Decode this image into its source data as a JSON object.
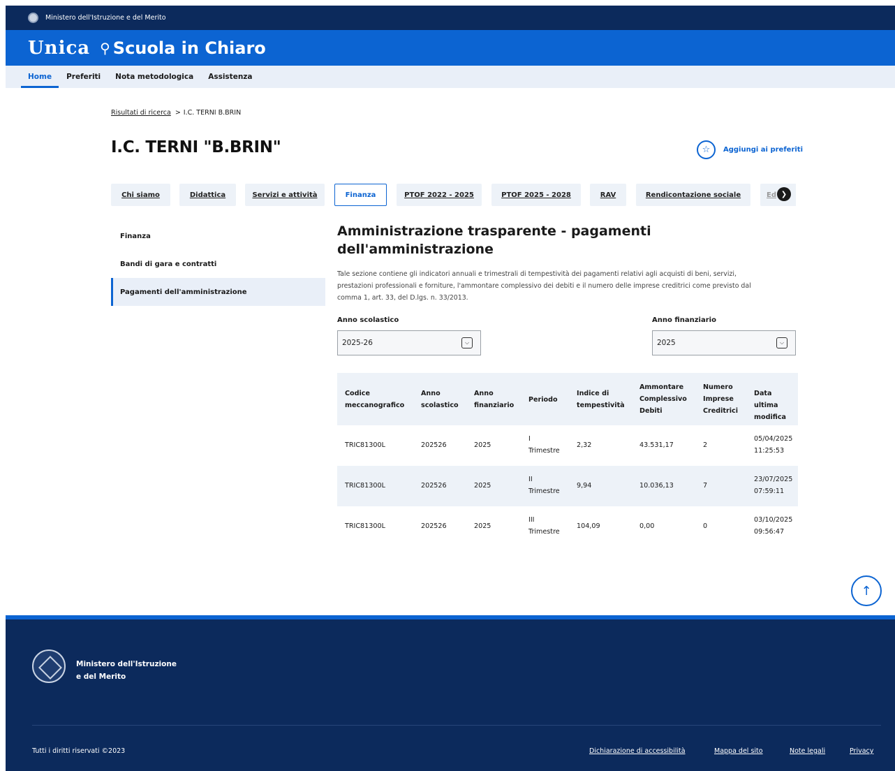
{
  "topbar": {
    "ministry": "Ministero dell'Istruzione e del Merito"
  },
  "brand": {
    "unica": "Unica",
    "scuola": "Scuola in Chiaro"
  },
  "nav": {
    "items": [
      "Home",
      "Preferiti",
      "Nota metodologica",
      "Assistenza"
    ],
    "active": "Home"
  },
  "breadcrumb": {
    "link": "Risultati di ricerca",
    "separator": ">",
    "current": "I.C. TERNI B.BRIN"
  },
  "school": {
    "title": "I.C. TERNI \"B.BRIN\""
  },
  "favorites": {
    "label": "Aggiungi ai preferiti",
    "icon": "star-icon"
  },
  "tabs": {
    "items": [
      "Chi siamo",
      "Didattica",
      "Servizi e attività",
      "Finanza",
      "PTOF 2022 - 2025",
      "PTOF 2025 - 2028",
      "RAV",
      "Rendicontazione sociale",
      "Ed"
    ],
    "active": "Finanza"
  },
  "sidebar": {
    "items": [
      "Finanza",
      "Bandi di gara e contratti",
      "Pagamenti dell'amministrazione"
    ],
    "active": "Pagamenti dell'amministrazione"
  },
  "main": {
    "title_line1": "Amministrazione trasparente - pagamenti",
    "title_line2": "dell'amministrazione",
    "description_line1": "Tale sezione contiene gli indicatori annuali e trimestrali di tempestività dei pagamenti relativi agli acquisti di beni, servizi,",
    "description_line2": "prestazioni professionali e forniture, l'ammontare complessivo dei debiti e il numero delle imprese creditrici come previsto dal",
    "description_line3": "comma 1, art. 33, del D.lgs. n. 33/2013."
  },
  "filters": {
    "anno_scolastico": {
      "label": "Anno scolastico",
      "value": "2025-26"
    },
    "anno_finanziario": {
      "label": "Anno finanziario",
      "value": "2025"
    }
  },
  "table": {
    "headers": [
      [
        "Codice",
        "meccanografico"
      ],
      [
        "Anno",
        "scolastico"
      ],
      [
        "Anno",
        "finanziario"
      ],
      [
        "Periodo"
      ],
      [
        "Indice di",
        "tempestività"
      ],
      [
        "Ammontare",
        "Complessivo",
        "Debiti"
      ],
      [
        "Numero",
        "Imprese",
        "Creditrici"
      ],
      [
        "Data ultima",
        "modifica"
      ]
    ],
    "rows": [
      {
        "codice": "TRIC81300L",
        "anno_scol": "202526",
        "anno_fin": "2025",
        "periodo_num": "I",
        "periodo_label": "Trimestre",
        "indice": "2,32",
        "ammontare": "43.531,17",
        "imprese": "2",
        "data": "05/04/2025",
        "ora": "11:25:53"
      },
      {
        "codice": "TRIC81300L",
        "anno_scol": "202526",
        "anno_fin": "2025",
        "periodo_num": "II",
        "periodo_label": "Trimestre",
        "indice": "9,94",
        "ammontare": "10.036,13",
        "imprese": "7",
        "data": "23/07/2025",
        "ora": "07:59:11"
      },
      {
        "codice": "TRIC81300L",
        "anno_scol": "202526",
        "anno_fin": "2025",
        "periodo_num": "III",
        "periodo_label": "Trimestre",
        "indice": "104,09",
        "ammontare": "0,00",
        "imprese": "0",
        "data": "03/10/2025",
        "ora": "09:56:47"
      }
    ]
  },
  "footer": {
    "ministry_line1": "Ministero dell'Istruzione",
    "ministry_line2": "e del Merito",
    "copyright": "Tutti i diritti riservati ©2023",
    "links": [
      "Dichiarazione di accessibilità",
      "Mappa del sito",
      "Note legali",
      "Privacy"
    ]
  },
  "colors": {
    "primary": "#0c64d2",
    "dark": "#0c2a5c",
    "light_bg": "#edf2f8"
  }
}
